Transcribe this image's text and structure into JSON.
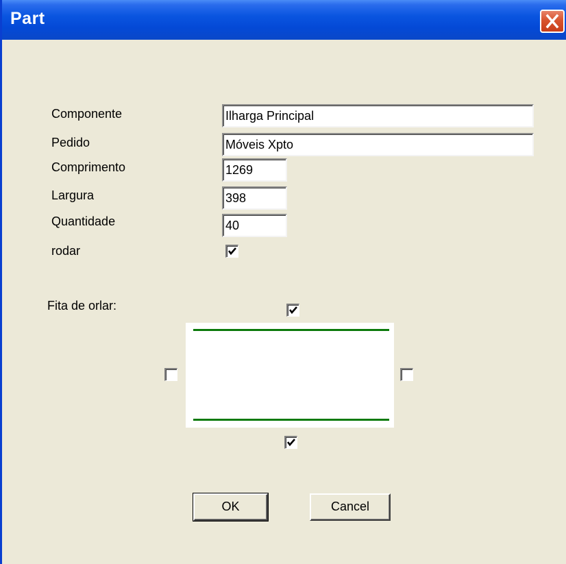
{
  "window": {
    "title": "Part"
  },
  "form": {
    "componente": {
      "label": "Componente",
      "value": "Ilharga Principal"
    },
    "pedido": {
      "label": "Pedido",
      "value": "Móveis Xpto"
    },
    "comprimento": {
      "label": "Comprimento",
      "value": "1269"
    },
    "largura": {
      "label": "Largura",
      "value": "398"
    },
    "quantidade": {
      "label": "Quantidade",
      "value": "40"
    },
    "rodar": {
      "label": "rodar",
      "checked": true
    }
  },
  "edge_banding": {
    "label": "Fita de orlar:",
    "top": true,
    "bottom": true,
    "left": false,
    "right": false,
    "edge_color": "#0b7a0b"
  },
  "buttons": {
    "ok": "OK",
    "cancel": "Cancel"
  },
  "icons": {
    "close": "close-icon",
    "check": "checkmark-icon"
  }
}
